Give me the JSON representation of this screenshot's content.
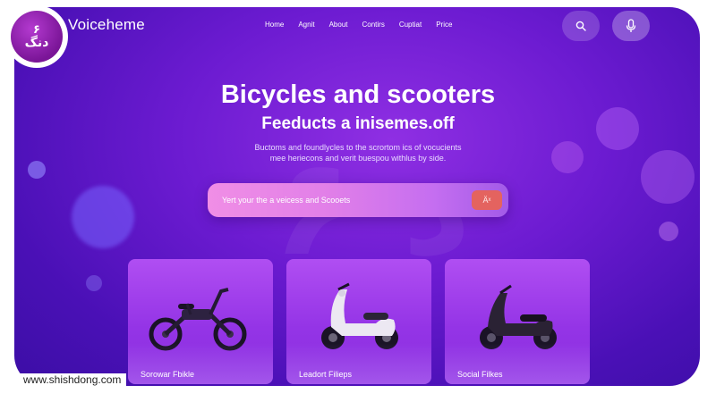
{
  "logo": {
    "line1": "۶",
    "line2": "دنگ"
  },
  "brand": {
    "name": "Voiceheme"
  },
  "nav": [
    "Home",
    "Agnit",
    "About",
    "Contirs",
    "Cuptiat",
    "Price"
  ],
  "header_icons": [
    "search-icon",
    "microphone-icon"
  ],
  "hero": {
    "title": "Bicycles and scooters",
    "subtitle": "Feeducts a inisemes.off",
    "description_line1": "Buctoms and foundlycles to the scrortom ics of vocucients",
    "description_line2": "mee heriecons and verit buespou withlus by side."
  },
  "search": {
    "placeholder": "Yert your the a veicess and Scooets",
    "button_label": "Äˣ"
  },
  "cards": [
    {
      "label": "Sorowar Fbikle",
      "icon": "electric-bike-image"
    },
    {
      "label": "Leadort Filieps",
      "icon": "scooter-image"
    },
    {
      "label": "Social Filkes",
      "icon": "electric-scooter-image"
    }
  ],
  "footer": {
    "url": "www.shishdong.com"
  },
  "colors": {
    "background": "#6c1bd1",
    "accent": "#e4635f",
    "search_gradient_start": "#f08ee6"
  }
}
